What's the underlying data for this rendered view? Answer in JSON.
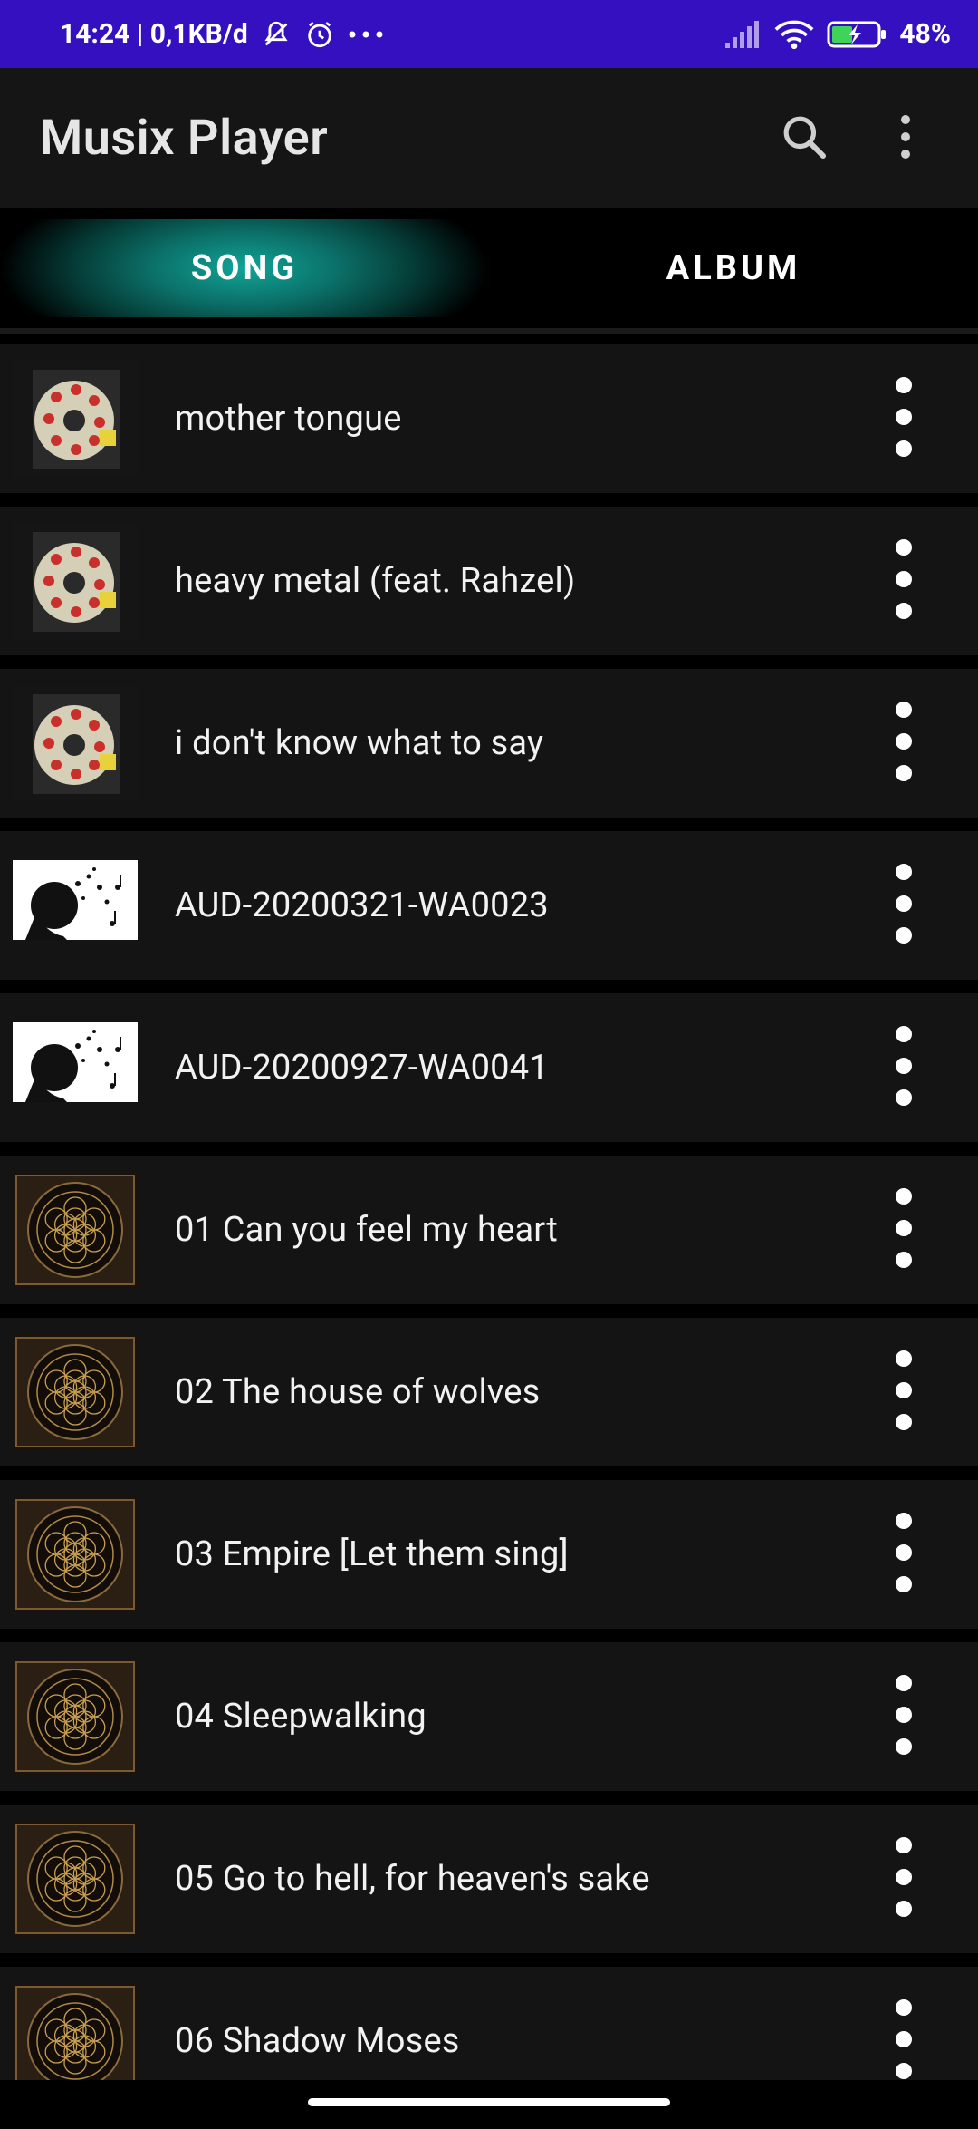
{
  "status_bar": {
    "time_info": "14:24 | 0,1KB/d",
    "battery": "48%"
  },
  "app": {
    "title": "Musix Player"
  },
  "tabs": [
    {
      "label": "SONG",
      "active": true
    },
    {
      "label": "ALBUM",
      "active": false
    }
  ],
  "songs": [
    {
      "title": "mother tongue",
      "art": "cd-hearts"
    },
    {
      "title": "heavy metal (feat. Rahzel)",
      "art": "cd-hearts"
    },
    {
      "title": "i don't know what to say",
      "art": "cd-hearts"
    },
    {
      "title": "AUD-20200321-WA0023",
      "art": "silhouette-notes"
    },
    {
      "title": "AUD-20200927-WA0041",
      "art": "silhouette-notes"
    },
    {
      "title": "01 Can you feel my heart",
      "art": "sempiternal"
    },
    {
      "title": "02 The house of wolves",
      "art": "sempiternal"
    },
    {
      "title": "03 Empire [Let them sing]",
      "art": "sempiternal"
    },
    {
      "title": "04 Sleepwalking",
      "art": "sempiternal"
    },
    {
      "title": "05 Go to hell, for heaven's sake",
      "art": "sempiternal"
    },
    {
      "title": "06 Shadow Moses",
      "art": "sempiternal"
    }
  ],
  "colors": {
    "status_bar": "#3510c0",
    "accent": "#11a497",
    "row_bg": "#141414"
  }
}
